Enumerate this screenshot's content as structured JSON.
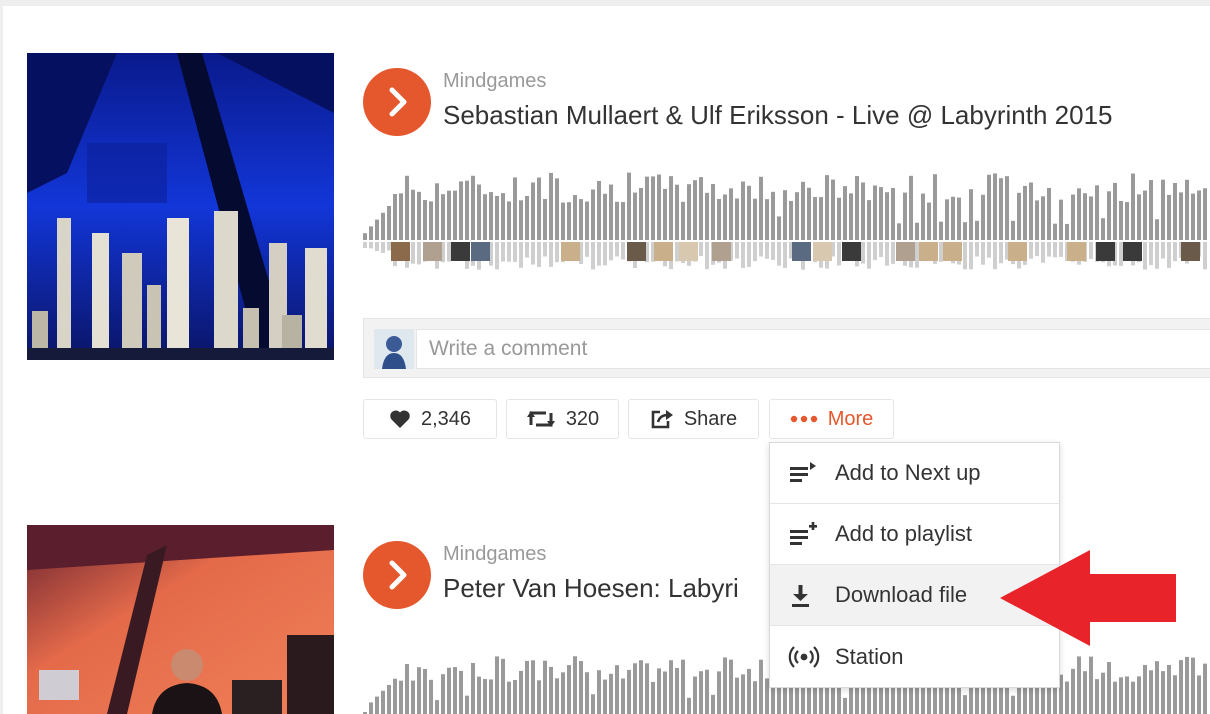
{
  "colors": {
    "accent": "#e5572c",
    "annotation_arrow": "#e8242a",
    "waveform_bar": "#9a9a9a",
    "text_primary": "#333333",
    "text_secondary": "#999999"
  },
  "tracks": [
    {
      "uploader": "Mindgames",
      "title": "Sebastian Mullaert & Ulf Eriksson - Live @ Labyrinth 2015",
      "play_icon": "play-icon"
    },
    {
      "uploader": "Mindgames",
      "title": "Peter Van Hoesen: Labyri",
      "play_icon": "play-icon"
    }
  ],
  "comment": {
    "placeholder": "Write a comment"
  },
  "actions": {
    "like_count": "2,346",
    "repost_count": "320",
    "share_label": "Share",
    "more_label": "More"
  },
  "more_menu": {
    "items": [
      {
        "label": "Add to Next up",
        "icon": "next-up-icon"
      },
      {
        "label": "Add to playlist",
        "icon": "add-playlist-icon"
      },
      {
        "label": "Download file",
        "icon": "download-icon",
        "highlighted": true
      },
      {
        "label": "Station",
        "icon": "station-icon"
      }
    ]
  }
}
